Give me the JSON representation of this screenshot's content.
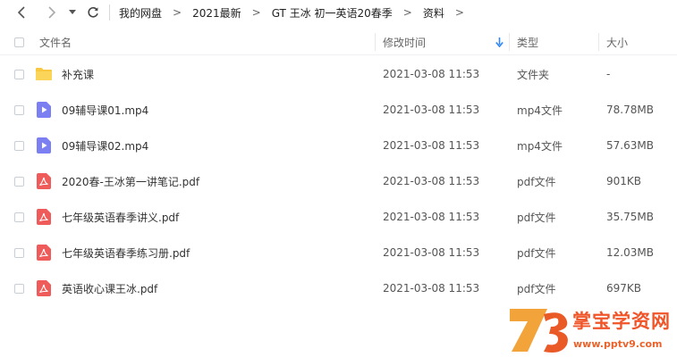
{
  "nav": {
    "breadcrumbs": [
      "我的网盘",
      "2021最新",
      "GT 王冰 初一英语20春季",
      "资料"
    ]
  },
  "columns": {
    "name": "文件名",
    "time": "修改时间",
    "type": "类型",
    "size": "大小"
  },
  "files": [
    {
      "name": "补充课",
      "time": "2021-03-08 11:53",
      "type": "文件夹",
      "size": "-",
      "icon": "folder-icon"
    },
    {
      "name": "09辅导课01.mp4",
      "time": "2021-03-08 11:53",
      "type": "mp4文件",
      "size": "78.78MB",
      "icon": "video-file-icon"
    },
    {
      "name": "09辅导课02.mp4",
      "time": "2021-03-08 11:53",
      "type": "mp4文件",
      "size": "57.63MB",
      "icon": "video-file-icon"
    },
    {
      "name": "2020春-王冰第一讲笔记.pdf",
      "time": "2021-03-08 11:53",
      "type": "pdf文件",
      "size": "901KB",
      "icon": "pdf-file-icon"
    },
    {
      "name": "七年级英语春季讲义.pdf",
      "time": "2021-03-08 11:53",
      "type": "pdf文件",
      "size": "35.75MB",
      "icon": "pdf-file-icon"
    },
    {
      "name": "七年级英语春季练习册.pdf",
      "time": "2021-03-08 11:53",
      "type": "pdf文件",
      "size": "12.03MB",
      "icon": "pdf-file-icon"
    },
    {
      "name": "英语收心课王冰.pdf",
      "time": "2021-03-08 11:53",
      "type": "pdf文件",
      "size": "697KB",
      "icon": "pdf-file-icon"
    }
  ],
  "watermark": {
    "logo_text": "掌宝学资网",
    "url": "www.pptv9.com"
  },
  "colors": {
    "folder": "#f8c940",
    "video": "#7b7ff2",
    "pdf": "#ef5b5b",
    "sort_arrow": "#2f86f6",
    "watermark": "#f0552a"
  }
}
